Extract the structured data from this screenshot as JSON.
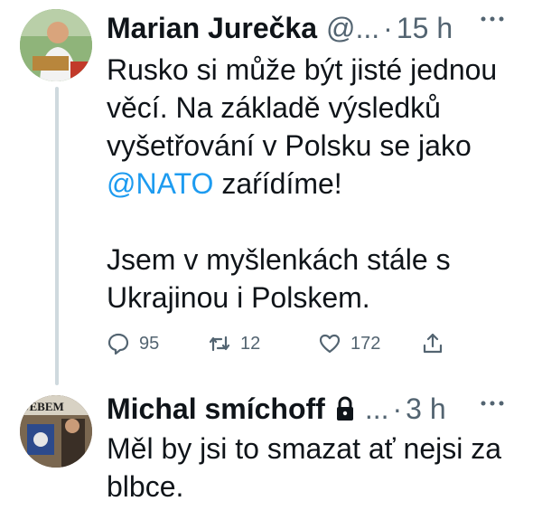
{
  "tweets": [
    {
      "name": "Marian Jurečka",
      "handle": "@...",
      "separator": "·",
      "time": "15 h",
      "avatar_icon": "user-avatar-photo",
      "body_text": {
        "part1": "Rusko si může být jisté jednou věcí. Na základě výsledků vyšetřování v Polsku se jako ",
        "mention": "@NATO",
        "part2": " zaŕídíme!",
        "paragraph2": "Jsem v myšlenkách stále s Ukrajinou i Polskem."
      },
      "actions": {
        "replies": "95",
        "retweets": "12",
        "likes": "172"
      }
    },
    {
      "name": "Michal smíchoff",
      "handle": "...",
      "separator": "·",
      "time": "3 h",
      "avatar_icon": "user-avatar-photo",
      "avatar_text": "JEBEM",
      "body_text": "Měl by jsi to smazat ať nejsi za blbce."
    }
  ],
  "colors": {
    "text": "#0f1419",
    "secondary": "#536471",
    "accent": "#1d9bf0",
    "thread_line": "#cfd9de"
  }
}
